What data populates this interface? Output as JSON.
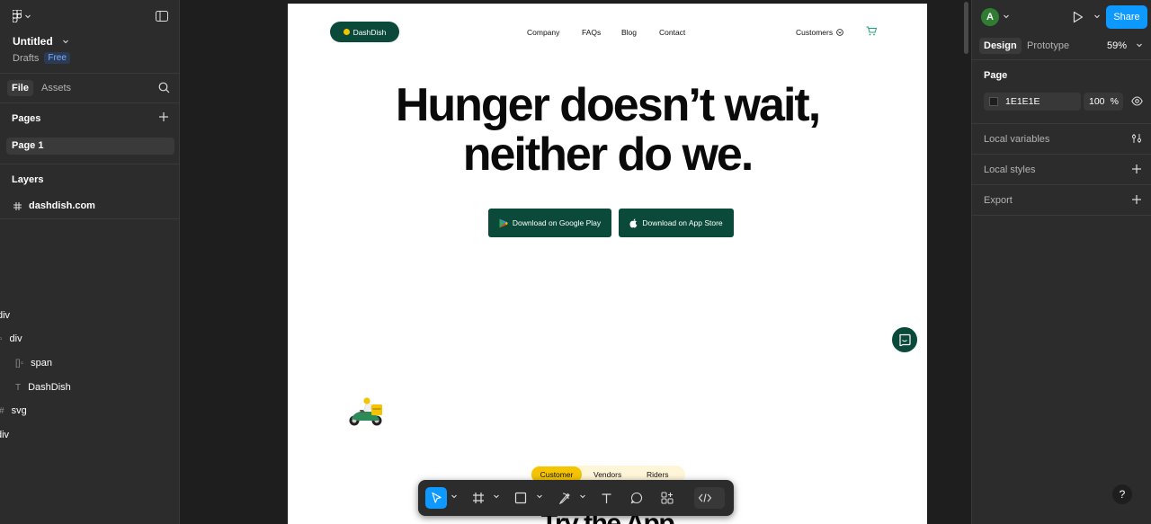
{
  "file": {
    "title": "Untitled",
    "drafts_label": "Drafts",
    "plan_badge": "Free"
  },
  "left_tabs": {
    "file": "File",
    "assets": "Assets"
  },
  "pages": {
    "header": "Pages",
    "items": [
      "Page 1"
    ]
  },
  "layers": {
    "header": "Layers",
    "frame": "dashdish.com",
    "ghost_rows": [
      "div",
      "div",
      "span",
      "DashDish",
      "svg",
      "div"
    ]
  },
  "site": {
    "brand": "DashDish",
    "nav": [
      "Company",
      "FAQs",
      "Blog",
      "Contact"
    ],
    "customers_menu": "Customers",
    "hero_line1": "Hunger doesn’t wait,",
    "hero_line2": "neither do we.",
    "google_play": "Download on Google Play",
    "app_store": "Download on App Store",
    "segments": [
      "Customer",
      "Vendors",
      "Riders"
    ],
    "section_title": "Try the App"
  },
  "right": {
    "avatar_letter": "A",
    "share": "Share",
    "tabs": {
      "design": "Design",
      "prototype": "Prototype"
    },
    "zoom": "59%",
    "page_section": "Page",
    "page_color": "1E1E1E",
    "page_opacity": "100",
    "opacity_unit": "%",
    "local_variables": "Local variables",
    "local_styles": "Local styles",
    "export": "Export",
    "help": "?"
  },
  "colors": {
    "accent": "#0d99ff",
    "brand_green": "#0b4a3a",
    "brand_yellow": "#f5c400",
    "canvas_bg": "#1e1e1e",
    "panel_bg": "#2c2c2c"
  }
}
